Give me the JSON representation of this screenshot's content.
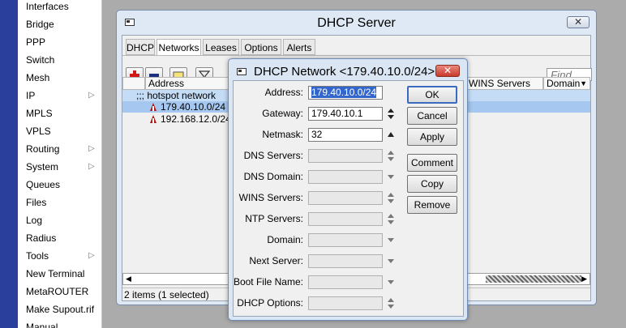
{
  "sidebar": {
    "items": [
      {
        "label": "Interfaces",
        "submenu": false
      },
      {
        "label": "Bridge",
        "submenu": false
      },
      {
        "label": "PPP",
        "submenu": false
      },
      {
        "label": "Switch",
        "submenu": false
      },
      {
        "label": "Mesh",
        "submenu": false
      },
      {
        "label": "IP",
        "submenu": true
      },
      {
        "label": "MPLS",
        "submenu": false
      },
      {
        "label": "VPLS",
        "submenu": false
      },
      {
        "label": "Routing",
        "submenu": true
      },
      {
        "label": "System",
        "submenu": true
      },
      {
        "label": "Queues",
        "submenu": false
      },
      {
        "label": "Files",
        "submenu": false
      },
      {
        "label": "Log",
        "submenu": false
      },
      {
        "label": "Radius",
        "submenu": false
      },
      {
        "label": "Tools",
        "submenu": true
      },
      {
        "label": "New Terminal",
        "submenu": false
      },
      {
        "label": "MetaROUTER",
        "submenu": false
      },
      {
        "label": "Make Supout.rif",
        "submenu": false
      },
      {
        "label": "Manual",
        "submenu": false
      }
    ],
    "submenu_glyph": "▷"
  },
  "server_window": {
    "title": "DHCP Server",
    "close_glyph": "✕",
    "tabs": [
      "DHCP",
      "Networks",
      "Leases",
      "Options",
      "Alerts"
    ],
    "active_tab": "Networks",
    "find_placeholder": "Find",
    "columns": {
      "address": "Address",
      "wins": "WINS Servers",
      "domain": "Domain"
    },
    "rows": [
      {
        "text": ";;; hotspot network",
        "type": "comment"
      },
      {
        "text": "179.40.10.0/24",
        "type": "entry",
        "selected": true
      },
      {
        "text": "192.168.12.0/24",
        "type": "entry",
        "selected": false
      }
    ],
    "status": "2 items (1 selected)"
  },
  "dialog": {
    "title": "DHCP Network <179.40.10.0/24>",
    "fields": [
      {
        "label": "Address:",
        "value": "179.40.10.0/24",
        "enabled": true,
        "control": "none",
        "highlight": true
      },
      {
        "label": "Gateway:",
        "value": "179.40.10.1",
        "enabled": true,
        "control": "updown"
      },
      {
        "label": "Netmask:",
        "value": "32",
        "enabled": true,
        "control": "up"
      },
      {
        "label": "DNS Servers:",
        "value": "",
        "enabled": false,
        "control": "updown"
      },
      {
        "label": "DNS Domain:",
        "value": "",
        "enabled": false,
        "control": "down"
      },
      {
        "label": "WINS Servers:",
        "value": "",
        "enabled": false,
        "control": "updown"
      },
      {
        "label": "NTP Servers:",
        "value": "",
        "enabled": false,
        "control": "updown"
      },
      {
        "label": "Domain:",
        "value": "",
        "enabled": false,
        "control": "down"
      },
      {
        "label": "Next Server:",
        "value": "",
        "enabled": false,
        "control": "down"
      },
      {
        "label": "Boot File Name:",
        "value": "",
        "enabled": false,
        "control": "down"
      },
      {
        "label": "DHCP Options:",
        "value": "",
        "enabled": false,
        "control": "updown"
      }
    ],
    "buttons": [
      "OK",
      "Cancel",
      "Apply",
      "Comment",
      "Copy",
      "Remove"
    ]
  }
}
